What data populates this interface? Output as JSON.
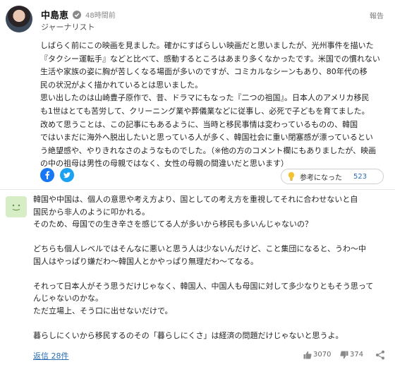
{
  "expert_comment": {
    "author_name": "中島恵",
    "posted_time": "48時間前",
    "author_role": "ジャーナリスト",
    "report_label": "報告",
    "text_lines": [
      "しばらく前にこの映画を見ました。確かにすばらしい映画だと思いましたが、光州事件を描いた",
      "『タクシー運転手』などと比べて、感動するところはあまり多くなかったです。米国での慣れない",
      "生活や家族の姿に胸が苦しくなる場面が多いのですが、コミカルなシーンもあり、80年代の移",
      "民の状況がよく描かれているとは思いました。",
      "思い出したのは山崎豊子原作で、昔、ドラマにもなった『二つの祖国』。日本人のアメリカ移民",
      "も1世はとても苦労して、クリーニング業や葬儀業などに従事し、必死で子どもを育てました。",
      "改めて思うことは、この記事にもあるように、当時と移民事情は変わっているものの、韓国",
      "ではいまだに海外へ脱出したいと思っている人が多く、韓国社会に重い閉塞感が漂っているとい",
      "う絶望感や、やりきれなさのようなものでした。（※他の方のコメント欄にもありましたが、映画",
      "の中の祖母は男性の母親ではなく、女性の母親の間違いだと思います）"
    ],
    "helpful_label": "参考になった",
    "helpful_count": "523"
  },
  "user_comment": {
    "text_lines": [
      "韓国や中国は、個人の意思や考え方より、国としての考え方を重視してそれに合わせないと自",
      "国民から非人のように叩かれる。",
      "そのため、母国での生き辛さを感じてる人が多いから移民も多いんじゃないの？",
      "",
      "どちらも個人レベルではそんなに悪いと思う人は少ないんだけど、こと集団になると、うわ～中",
      "国人はやっぱり嫌だわ～韓国人とかやっぱり無理だわ～てなる。",
      "",
      "それって日本人がそう思うだけじゃなく、韓国人、中国人も母国に対して多少なりともそう思って",
      "んじゃないのかな。",
      "ただ立場上、そう口に出せないだけで。",
      "",
      "暮らしにくいから移民するのその「暮らしにくさ」は経済の問題だけじゃないと思うよ。"
    ],
    "reply_label": "返信 28件",
    "like_count": "3070",
    "dislike_count": "374"
  },
  "colors": {
    "link_blue": "#2a6db5",
    "facebook_blue": "#1877f2",
    "twitter_blue": "#1da1f2",
    "bulb_yellow": "#f2c230",
    "user_avatar_green": "#d7edc6"
  },
  "icons": [
    "verified-icon",
    "facebook-icon",
    "twitter-icon",
    "bulb-icon",
    "thumbs-up-icon",
    "thumbs-down-icon",
    "share-icon"
  ]
}
